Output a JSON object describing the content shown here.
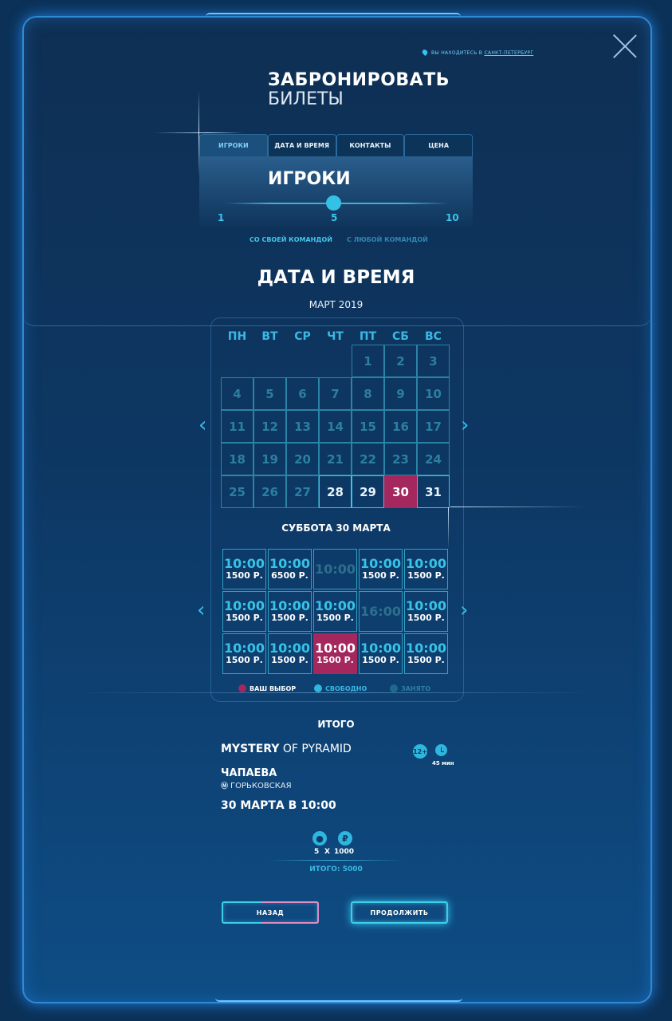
{
  "header": {
    "location_prefix": "ВЫ НАХОДИТЕСЬ В",
    "location_city": "САНКТ-ПЕТЕРБУРГ",
    "title_line1": "ЗАБРОНИРОВАТЬ",
    "title_line2": "БИЛЕТЫ"
  },
  "tabs": [
    {
      "label": "ИГРОКИ",
      "active": true
    },
    {
      "label": "ДАТА И ВРЕМЯ",
      "active": false
    },
    {
      "label": "КОНТАКТЫ",
      "active": false
    },
    {
      "label": "ЦЕНА",
      "active": false
    }
  ],
  "players": {
    "title": "ИГРОКИ",
    "min": "1",
    "current": "5",
    "max": "10",
    "value_fraction": 0.44,
    "option_own_team": "СО СВОЕЙ КОМАНДОЙ",
    "option_any_team": "С ЛЮБОЙ КОМАНДОЙ"
  },
  "calendar": {
    "title": "ДАТА И ВРЕМЯ",
    "month": "МАРТ 2019",
    "weekdays": [
      "ПН",
      "ВТ",
      "СР",
      "ЧТ",
      "ПТ",
      "СБ",
      "ВС"
    ],
    "days": [
      "1",
      "2",
      "3",
      "4",
      "5",
      "6",
      "7",
      "8",
      "9",
      "10",
      "11",
      "12",
      "13",
      "14",
      "15",
      "16",
      "17",
      "18",
      "19",
      "20",
      "21",
      "22",
      "23",
      "24",
      "25",
      "26",
      "27",
      "28",
      "29",
      "30",
      "31"
    ],
    "available_days": [
      "28",
      "29",
      "31"
    ],
    "selected_day": "30",
    "prev_icon": "chevron-left-icon",
    "next_icon": "chevron-right-icon"
  },
  "schedule": {
    "day_label": "СУББОТА 30 МАРТА",
    "slots": [
      {
        "time": "10:00",
        "price": "1500 Р.",
        "state": "free"
      },
      {
        "time": "10:00",
        "price": "6500 Р.",
        "state": "free"
      },
      {
        "time": "10:00",
        "price": "",
        "state": "busy"
      },
      {
        "time": "10:00",
        "price": "1500 Р.",
        "state": "free"
      },
      {
        "time": "10:00",
        "price": "1500 Р.",
        "state": "free"
      },
      {
        "time": "10:00",
        "price": "1500 Р.",
        "state": "free"
      },
      {
        "time": "10:00",
        "price": "1500 Р.",
        "state": "free"
      },
      {
        "time": "10:00",
        "price": "1500 Р.",
        "state": "free"
      },
      {
        "time": "16:00",
        "price": "",
        "state": "busy"
      },
      {
        "time": "10:00",
        "price": "1500 Р.",
        "state": "free"
      },
      {
        "time": "10:00",
        "price": "1500 Р.",
        "state": "free"
      },
      {
        "time": "10:00",
        "price": "1500 Р.",
        "state": "free"
      },
      {
        "time": "10:00",
        "price": "1500 Р.",
        "state": "selected"
      },
      {
        "time": "10:00",
        "price": "1500 Р.",
        "state": "free"
      },
      {
        "time": "10:00",
        "price": "1500 Р.",
        "state": "free"
      }
    ]
  },
  "legend": {
    "selected": "ВАШ ВЫБОР",
    "free": "СВОБОДНО",
    "busy": "ЗАНЯТО",
    "colors": {
      "selected": "#a4275e",
      "free": "#2fb6df",
      "busy": "#1d6a8c"
    }
  },
  "summary": {
    "title": "ИТОГО",
    "game_part1": "MYSTERY",
    "game_part2": "OF PYRAMID",
    "age_badge": "12+",
    "duration": "45 мин",
    "street": "ЧАПАЕВА",
    "metro": "ГОРЬКОВСКАЯ",
    "datetime": "30 МАРТА В 10:00",
    "players_count": "5",
    "multiplier": "X",
    "price_per_player": "1000",
    "total": "ИТОГО: 5000"
  },
  "buttons": {
    "back": "НАЗАД",
    "next": "ПРОДОЛЖИТЬ"
  }
}
